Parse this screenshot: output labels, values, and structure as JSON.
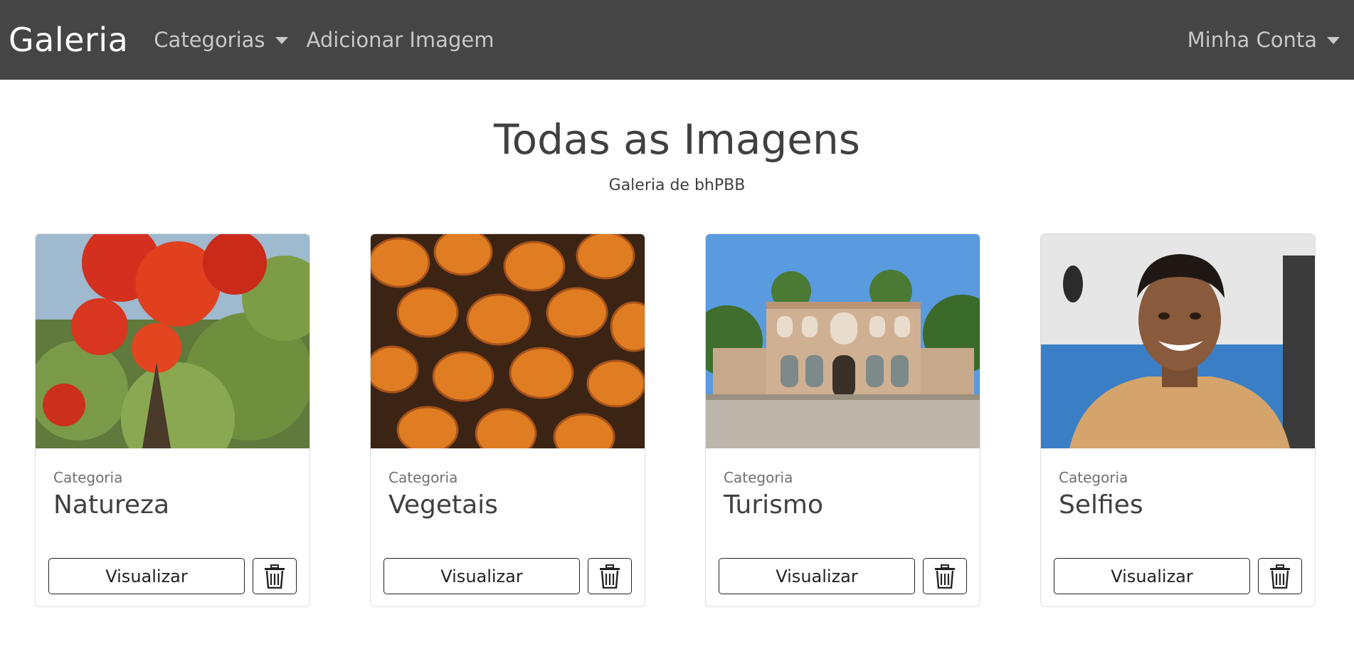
{
  "navbar": {
    "brand": "Galeria",
    "categories_label": "Categorias",
    "add_image_label": "Adicionar Imagem",
    "account_label": "Minha Conta"
  },
  "main": {
    "title": "Todas as Imagens",
    "subtitle": "Galeria de bhPBB"
  },
  "cards": [
    {
      "category_label": "Categoria",
      "category": "Natureza",
      "view_label": "Visualizar",
      "image": "red-flowering-tree-photo"
    },
    {
      "category_label": "Categoria",
      "category": "Vegetais",
      "view_label": "Visualizar",
      "image": "pumpkins-photo"
    },
    {
      "category_label": "Categoria",
      "category": "Turismo",
      "view_label": "Visualizar",
      "image": "palace-garden-photo"
    },
    {
      "category_label": "Categoria",
      "category": "Selfies",
      "view_label": "Visualizar",
      "image": "smiling-man-selfie-photo"
    }
  ],
  "icons": {
    "delete": "trash-icon",
    "dropdown": "caret-down-icon"
  },
  "colors": {
    "navbar_bg": "#464546",
    "brand": "#ffffff",
    "nav_link": "#c8c8c8",
    "text": "#404040"
  }
}
